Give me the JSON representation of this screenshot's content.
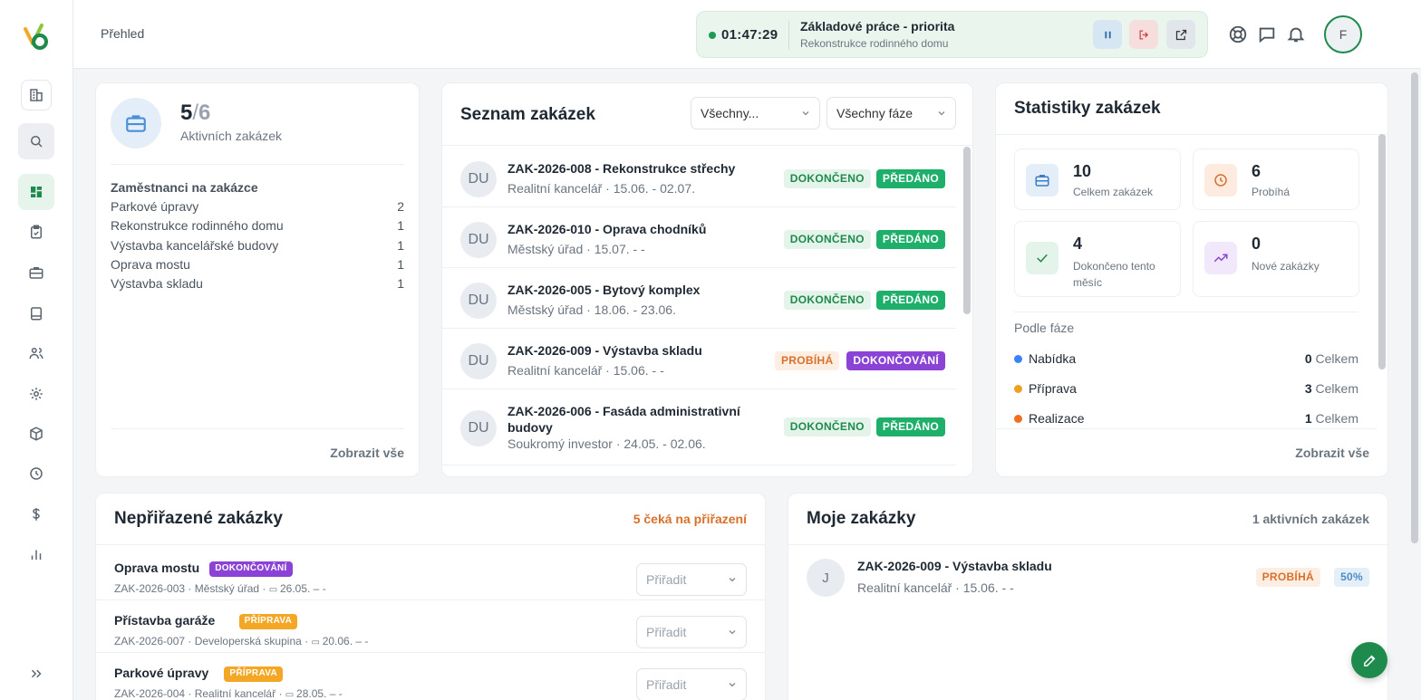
{
  "header": {
    "breadcrumb": "Přehled",
    "timer": {
      "time": "01:47:29",
      "task": "Základové práce - priorita",
      "project": "Rekonstrukce rodinného domu"
    },
    "user_initial": "F"
  },
  "active_jobs": {
    "active": "5",
    "slash": "/",
    "total": "6",
    "label": "Aktivních zakázek",
    "employees_title": "Zaměstnanci na zakázce",
    "employees": [
      {
        "name": "Parkové úpravy",
        "count": "2"
      },
      {
        "name": "Rekonstrukce rodinného domu",
        "count": "1"
      },
      {
        "name": "Výstavba kancelářské budovy",
        "count": "1"
      },
      {
        "name": "Oprava mostu",
        "count": "1"
      },
      {
        "name": "Výstavba skladu",
        "count": "1"
      }
    ],
    "show_all": "Zobrazit vše"
  },
  "job_list": {
    "title": "Seznam zakázek",
    "filter_status": "Všechny...",
    "filter_phase": "Všechny fáze",
    "jobs": [
      {
        "avatar": "DU",
        "title": "ZAK-2026-008 - Rekonstrukce střechy",
        "sub": "Realitní kancelář · 15.06. - 02.07.",
        "status": "DOKONČENO",
        "phase": "PŘEDÁNO"
      },
      {
        "avatar": "DU",
        "title": "ZAK-2026-010 - Oprava chodníků",
        "sub": "Městský úřad · 15.07. - -",
        "status": "DOKONČENO",
        "phase": "PŘEDÁNO"
      },
      {
        "avatar": "DU",
        "title": "ZAK-2026-005 - Bytový komplex",
        "sub": "Městský úřad · 18.06. - 23.06.",
        "status": "DOKONČENO",
        "phase": "PŘEDÁNO"
      },
      {
        "avatar": "DU",
        "title": "ZAK-2026-009 - Výstavba skladu",
        "sub": "Realitní kancelář · 15.06. - -",
        "status": "PROBÍHÁ",
        "phase": "DOKONČOVÁNÍ"
      },
      {
        "avatar": "DU",
        "title": "ZAK-2026-006 - Fasáda administrativní budovy",
        "sub": "Soukromý investor · 24.05. - 02.06.",
        "status": "DOKONČENO",
        "phase": "PŘEDÁNO"
      }
    ]
  },
  "stats": {
    "title": "Statistiky zakázek",
    "tiles": [
      {
        "value": "10",
        "label": "Celkem zakázek",
        "icon": "briefcase-icon"
      },
      {
        "value": "6",
        "label": "Probíhá",
        "icon": "clock-icon"
      },
      {
        "value": "4",
        "label": "Dokončeno tento měsíc",
        "icon": "check-icon"
      },
      {
        "value": "0",
        "label": "Nové zakázky",
        "icon": "trend-up-icon"
      }
    ],
    "phase_title": "Podle fáze",
    "phases": [
      {
        "name": "Nabídka",
        "count": "0",
        "unit": "Celkem",
        "color": "#3b82f6"
      },
      {
        "name": "Příprava",
        "count": "3",
        "unit": "Celkem",
        "color": "#f0a020"
      },
      {
        "name": "Realizace",
        "count": "1",
        "unit": "Celkem",
        "color": "#f07020"
      }
    ],
    "show_all": "Zobrazit vše"
  },
  "unassigned": {
    "title": "Nepřiřazené zakázky",
    "waiting": "5 čeká na přiřazení",
    "assign_placeholder": "Přiřadit",
    "rows": [
      {
        "title": "Oprava mostu",
        "badge": "DOKONČOVÁNÍ",
        "code": "ZAK-2026-003",
        "client": "Městský úřad",
        "date": "26.05. – -"
      },
      {
        "title": "Přístavba garáže",
        "badge": "PŘÍPRAVA",
        "code": "ZAK-2026-007",
        "client": "Developerská skupina",
        "date": "20.06. – -"
      },
      {
        "title": "Parkové úpravy",
        "badge": "PŘÍPRAVA",
        "code": "ZAK-2026-004",
        "client": "Realitní kancelář",
        "date": "28.05. – -"
      }
    ]
  },
  "my_jobs": {
    "title": "Moje zakázky",
    "count": "1 aktivních zakázek",
    "item": {
      "avatar": "J",
      "title": "ZAK-2026-009 - Výstavba skladu",
      "sub": "Realitní kancelář · 15.06. - -",
      "status": "PROBÍHÁ",
      "percent": "50%"
    }
  },
  "colors": {
    "brand": "#1e8a4c",
    "done": "#1eb06a",
    "progress": "#d9702a",
    "finishing": "#8b43d6",
    "prep": "#f3a724"
  }
}
